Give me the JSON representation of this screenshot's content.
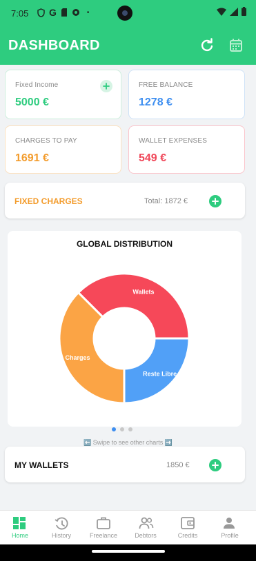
{
  "status_bar": {
    "time": "7:05",
    "g_letter": "G",
    "bullet": "•"
  },
  "header": {
    "title": "DASHBOARD",
    "refresh_icon": "refresh-icon",
    "calendar_icon": "calendar-icon"
  },
  "stats": {
    "fixed_income": {
      "label": "Fixed Income",
      "value": "5000 €",
      "color": "#2ecc7f"
    },
    "free_balance": {
      "label": "FREE BALANCE",
      "value": "1278 €",
      "color": "#3d8ef0"
    },
    "charges_to_pay": {
      "label": "CHARGES TO PAY",
      "value": "1691 €",
      "color": "#f39c2d"
    },
    "wallet_expenses": {
      "label": "WALLET EXPENSES",
      "value": "549 €",
      "color": "#f0485a"
    }
  },
  "fixed_charges": {
    "title": "FIXED CHARGES",
    "total": "Total: 1872 €"
  },
  "chart_data": {
    "type": "pie",
    "title": "GLOBAL DISTRIBUTION",
    "categories": [
      "Wallets",
      "Reste Libre",
      "Charges"
    ],
    "values": [
      37.5,
      25,
      37.5
    ],
    "colors": [
      "#f64859",
      "#51a0f7",
      "#fba445"
    ],
    "donut": true
  },
  "pagination": {
    "total": 3,
    "active": 0
  },
  "swipe_hint": "⬅️ Swipe to see other charts ➡️",
  "my_wallets": {
    "title": "MY WALLETS",
    "total": "1850 €"
  },
  "nav": [
    {
      "label": "Home",
      "icon": "dashboard-icon",
      "active": true
    },
    {
      "label": "History",
      "icon": "history-icon",
      "active": false
    },
    {
      "label": "Freelance",
      "icon": "briefcase-icon",
      "active": false
    },
    {
      "label": "Debtors",
      "icon": "people-icon",
      "active": false
    },
    {
      "label": "Credits",
      "icon": "wallet-icon",
      "active": false
    },
    {
      "label": "Profile",
      "icon": "person-icon",
      "active": false
    }
  ]
}
